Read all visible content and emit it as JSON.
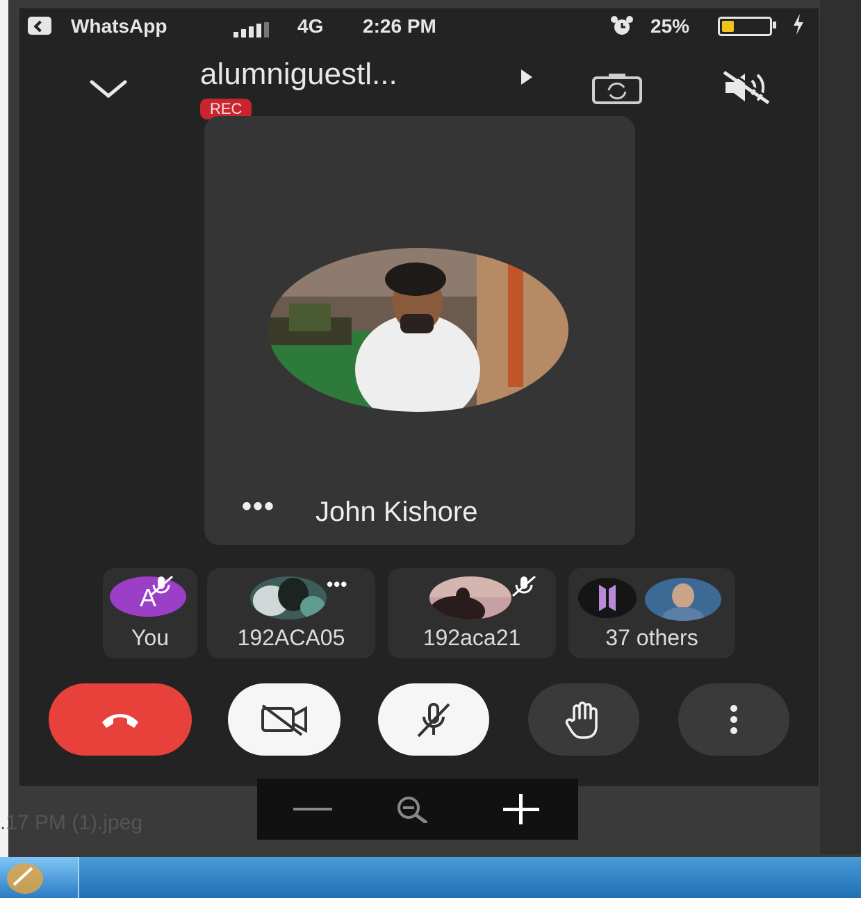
{
  "status_bar": {
    "app": "WhatsApp",
    "network": "4G",
    "time": "2:26 PM",
    "battery": "25%",
    "battery_level": 0.25,
    "signal_icon": "signal-bars-icon",
    "alarm_icon": "alarm-clock-icon",
    "charging_icon": "charging-bolt-icon"
  },
  "meeting": {
    "title": "alumniguestl...",
    "rec_label": "REC"
  },
  "main_tile": {
    "name": "John Kishore",
    "options": "•••"
  },
  "participants": [
    {
      "label": "You",
      "avatar_letter": "A",
      "muted": true
    },
    {
      "label": "192ACA05",
      "options": "•••"
    },
    {
      "label": "192aca21",
      "muted": true
    },
    {
      "label": "37 others"
    }
  ],
  "viewer": {
    "file_name": ".17 PM (1).jpeg"
  },
  "colors": {
    "end_call": "#e8403a",
    "rec": "#c9252f",
    "avatar_you": "#9b3fc7",
    "battery_fill": "#f0c21b"
  }
}
